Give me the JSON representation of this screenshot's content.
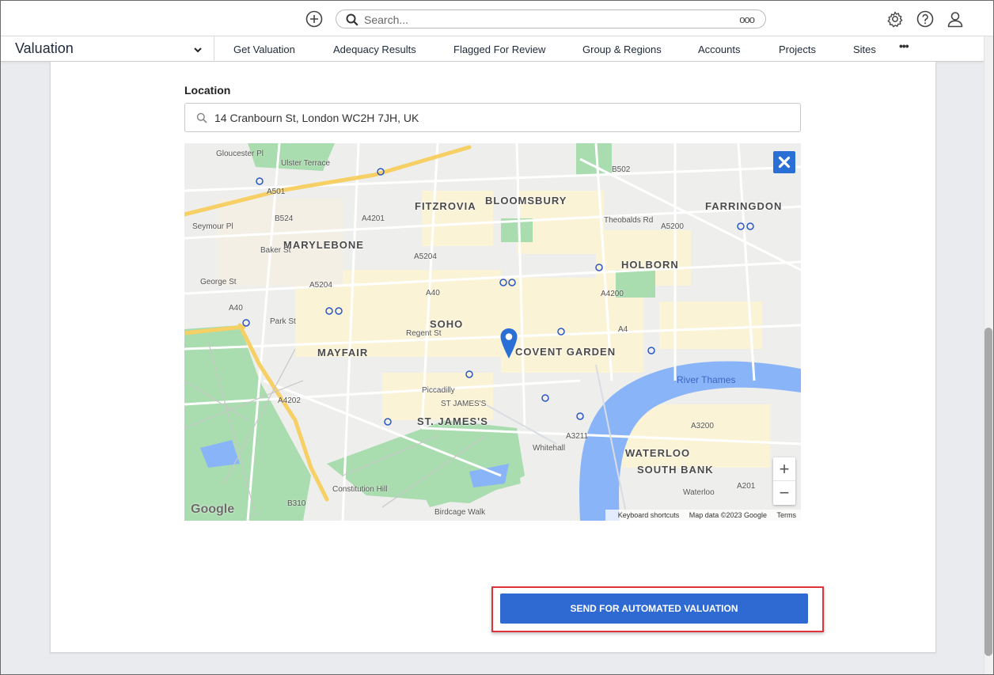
{
  "topbar": {
    "search_placeholder": "Search...",
    "search_more": "ooo"
  },
  "nav": {
    "app_title": "Valuation",
    "items": [
      "Get Valuation",
      "Adequacy Results",
      "Flagged For Review",
      "Group & Regions",
      "Accounts",
      "Projects",
      "Sites"
    ],
    "more": "•••"
  },
  "form": {
    "location_label": "Location",
    "location_value": "14 Cranbourn St, London WC2H 7JH, UK",
    "send_label": "SEND FOR AUTOMATED VALUATION"
  },
  "map": {
    "areas": [
      "FITZROVIA",
      "BLOOMSBURY",
      "FARRINGDON",
      "MARYLEBONE",
      "HOLBORN",
      "SOHO",
      "MAYFAIR",
      "COVENT GARDEN",
      "ST. JAMES'S",
      "WATERLOO",
      "SOUTH BANK"
    ],
    "small_labels": [
      "Ulster Terrace",
      "A501",
      "B524",
      "Baker St",
      "George St",
      "A5204",
      "A40",
      "Park St",
      "Regent St",
      "A4201",
      "A5204",
      "A40",
      "Theobalds Rd",
      "A5200",
      "A4200",
      "A4",
      "Piccadilly",
      "ST JAMES'S",
      "Whitehall",
      "A3211",
      "A4202",
      "Constitution Hill",
      "Birdcage Walk",
      "B310",
      "A3200",
      "Waterloo",
      "A201",
      "B502",
      "Gloucester Pl",
      "Seymour Pl"
    ],
    "river": "River Thames",
    "zoom_in": "+",
    "zoom_out": "−",
    "google": "Google",
    "keyboard": "Keyboard shortcuts",
    "map_data": "Map data ©2023 Google",
    "terms": "Terms"
  },
  "colors": {
    "accent": "#2e6ad1",
    "highlight": "#e0343b",
    "park": "#a9dcae",
    "water": "#8ab4f8",
    "major_road": "#f6cf65",
    "block": "#fbf3d6"
  }
}
